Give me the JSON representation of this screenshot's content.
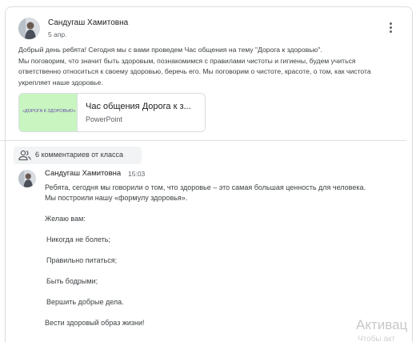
{
  "post": {
    "author": "Сандугаш Хамитовна",
    "date": "5 апр.",
    "lines": [
      "Добрый день ребята! Сегодня мы с вами проведем Час общения  на тему \"Дорога к здоровью\".",
      "Мы поговорим, что значит быть здоровым, познакомимся с правилами чистоты и гигиены, будем учиться",
      "ответственно относиться к своему здоровью, беречь его. Мы поговорим о чистоте, красоте, о том, как чистота",
      "укрепляет наше здоровье."
    ],
    "menu_icon": "more-vert-icon"
  },
  "attachment": {
    "title": "Час общения Дорога к з...",
    "type": "PowerPoint",
    "thumb_caption": "«ДОРОГА К ЗДОРОВЬЮ»",
    "thumb_color": "#c8f5c0"
  },
  "comments": {
    "count_label": "6 комментариев от класса",
    "icon": "people-icon"
  },
  "comment": {
    "author": "Сандугаш Хамитовна",
    "time": "15:03",
    "lines": [
      "Ребята, сегодня мы говорили о том, что здоровье – это самая большая ценность для человека.",
      "Мы построили нашу «формулу здоровья».",
      "Желаю вам:",
      "Никогда не болеть;",
      "Правильно питаться;",
      "Быть бодрыми;",
      "Вершить добрые дела.",
      "Вести здоровый образ жизни!"
    ]
  },
  "watermark": {
    "line1": "Активац",
    "line2": "Чтобы акт"
  }
}
